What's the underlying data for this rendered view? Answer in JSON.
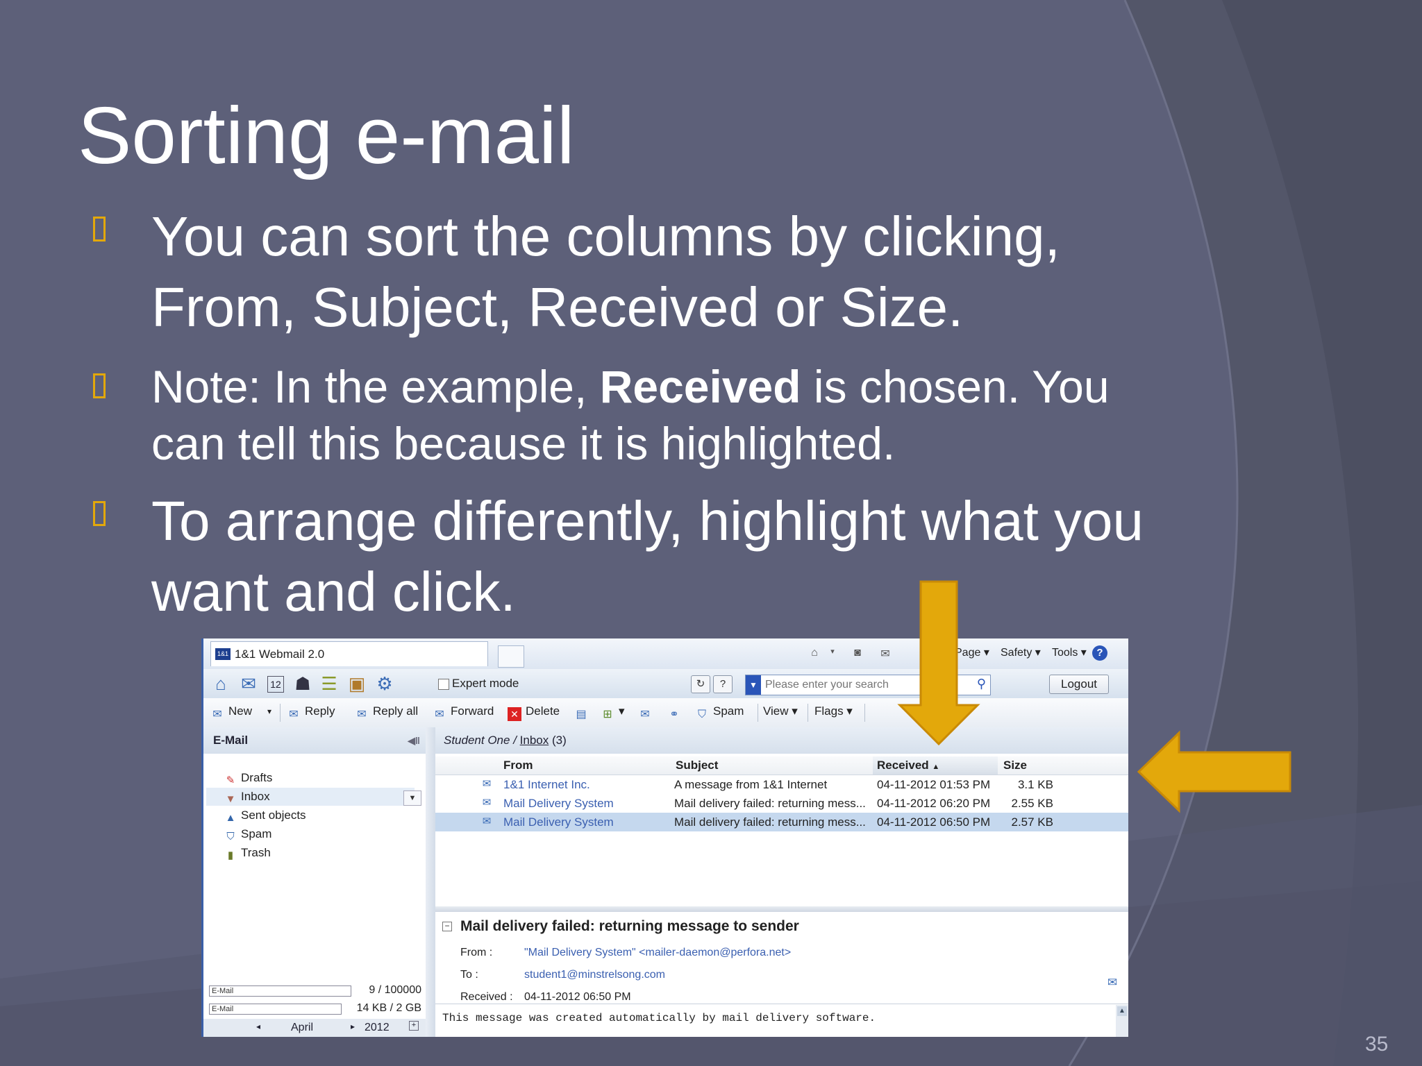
{
  "slide": {
    "title": "Sorting e-mail",
    "bullets": [
      {
        "text": "You can sort the columns by clicking, From, Subject, Received or Size."
      },
      {
        "pre": "Note: In the example, ",
        "bold": "Received",
        "post": " is chosen. You can tell this because it is highlighted."
      },
      {
        "text": "To arrange differently, highlight what you want and click."
      }
    ],
    "slide_number": "35",
    "accent_color": "#e3a80b",
    "background_color": "#5d6079"
  },
  "browser": {
    "tab_logo": "1&1",
    "tab_title": "1&1 Webmail 2.0",
    "menu": {
      "page": "Page",
      "safety": "Safety",
      "tools": "Tools",
      "help": "?"
    }
  },
  "app_toolbar": {
    "icons": [
      "home-icon",
      "mail-icon",
      "calendar-icon",
      "contacts-icon",
      "tasks-icon",
      "briefcase-icon",
      "settings-icon"
    ],
    "calendar_day": "12",
    "expert_mode_label": "Expert mode",
    "search_placeholder": "Please enter your search",
    "logout_label": "Logout"
  },
  "mail_toolbar": {
    "new": "New",
    "reply": "Reply",
    "reply_all": "Reply all",
    "forward": "Forward",
    "delete": "Delete",
    "spam": "Spam",
    "view": "View",
    "flags": "Flags"
  },
  "sidebar": {
    "header": "E-Mail",
    "folders": [
      "Drafts",
      "Inbox",
      "Sent objects",
      "Spam",
      "Trash"
    ],
    "quota": [
      {
        "label": "E-Mail",
        "value": "9 / 100000"
      },
      {
        "label": "E-Mail",
        "value": "14 KB / 2 GB"
      }
    ],
    "calendar": {
      "month": "April",
      "year": "2012"
    }
  },
  "mailbox": {
    "user": "Student One",
    "folder": "Inbox",
    "count": "(3)",
    "columns": {
      "from": "From",
      "subject": "Subject",
      "received": "Received",
      "size": "Size"
    },
    "sorted_by": "received",
    "messages": [
      {
        "from": "1&1 Internet Inc.",
        "subject": "A message from 1&1 Internet",
        "received": "04-11-2012 01:53 PM",
        "size": "3.1 KB",
        "selected": false
      },
      {
        "from": "Mail Delivery System",
        "subject": "Mail delivery failed: returning mess...",
        "received": "04-11-2012 06:20 PM",
        "size": "2.55 KB",
        "selected": false
      },
      {
        "from": "Mail Delivery System",
        "subject": "Mail delivery failed: returning mess...",
        "received": "04-11-2012 06:50 PM",
        "size": "2.57 KB",
        "selected": true
      }
    ]
  },
  "preview": {
    "title": "Mail delivery failed: returning message to sender",
    "from_label": "From :",
    "from_value": "\"Mail Delivery System\" <mailer-daemon@perfora.net>",
    "to_label": "To :",
    "to_value": "student1@minstrelsong.com",
    "received_label": "Received :",
    "received_value": "04-11-2012 06:50 PM",
    "body": "This message was created automatically by mail delivery software."
  }
}
